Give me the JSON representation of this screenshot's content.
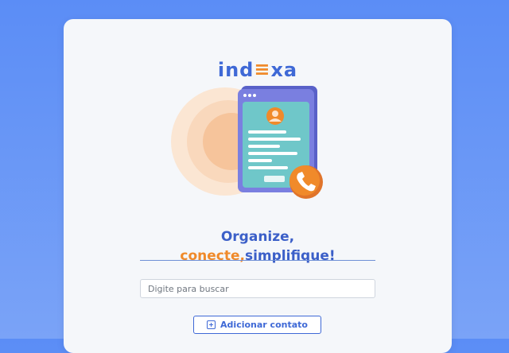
{
  "brand": {
    "logo_left": "ind",
    "logo_mark": "≡",
    "logo_right": "xa"
  },
  "tagline": {
    "line1": "Organize,",
    "line2_highlight": "conecte,",
    "line2_rest": "simplifique!"
  },
  "search": {
    "placeholder": "Digite para buscar",
    "value": ""
  },
  "actions": {
    "add_contact_label": "Adicionar contato",
    "add_contact_icon": "plus-square-icon"
  },
  "colors": {
    "primary": "#3f69d6",
    "accent": "#f08a2a",
    "background": "#5b8df6",
    "card": "#f5f7fa"
  }
}
